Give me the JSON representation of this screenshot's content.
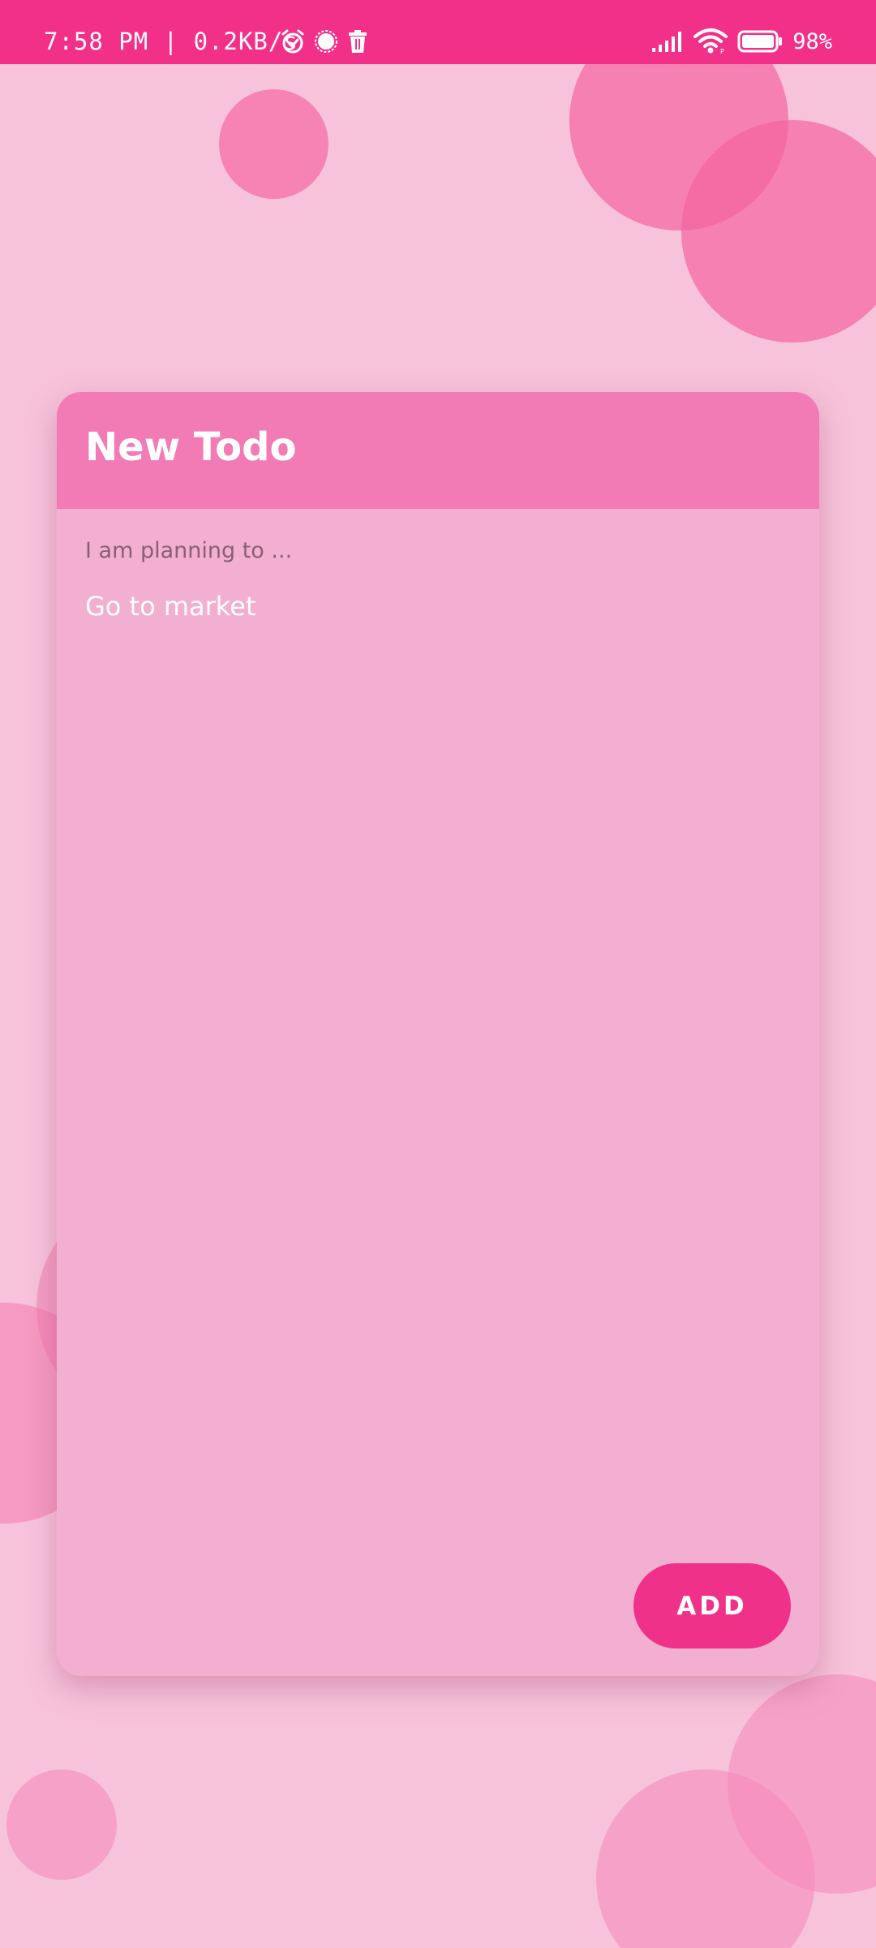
{
  "status_bar": {
    "time_and_speed": "7:58 PM | 0.2KB/s",
    "battery_percent": "98%",
    "icons": [
      "alarm-icon",
      "sync-icon",
      "trash-icon",
      "signal-icon",
      "wifi-icon",
      "battery-icon"
    ]
  },
  "dialog": {
    "title": "New Todo",
    "input_label": "I am planning to ...",
    "input_value": "Go to market",
    "add_label": "ADD"
  },
  "colors": {
    "status_bar": "#f2308a",
    "background": "#f7c3da",
    "card_header": "#f27bb5",
    "card_body": "#f3afd1",
    "add_button": "#ef3189"
  }
}
